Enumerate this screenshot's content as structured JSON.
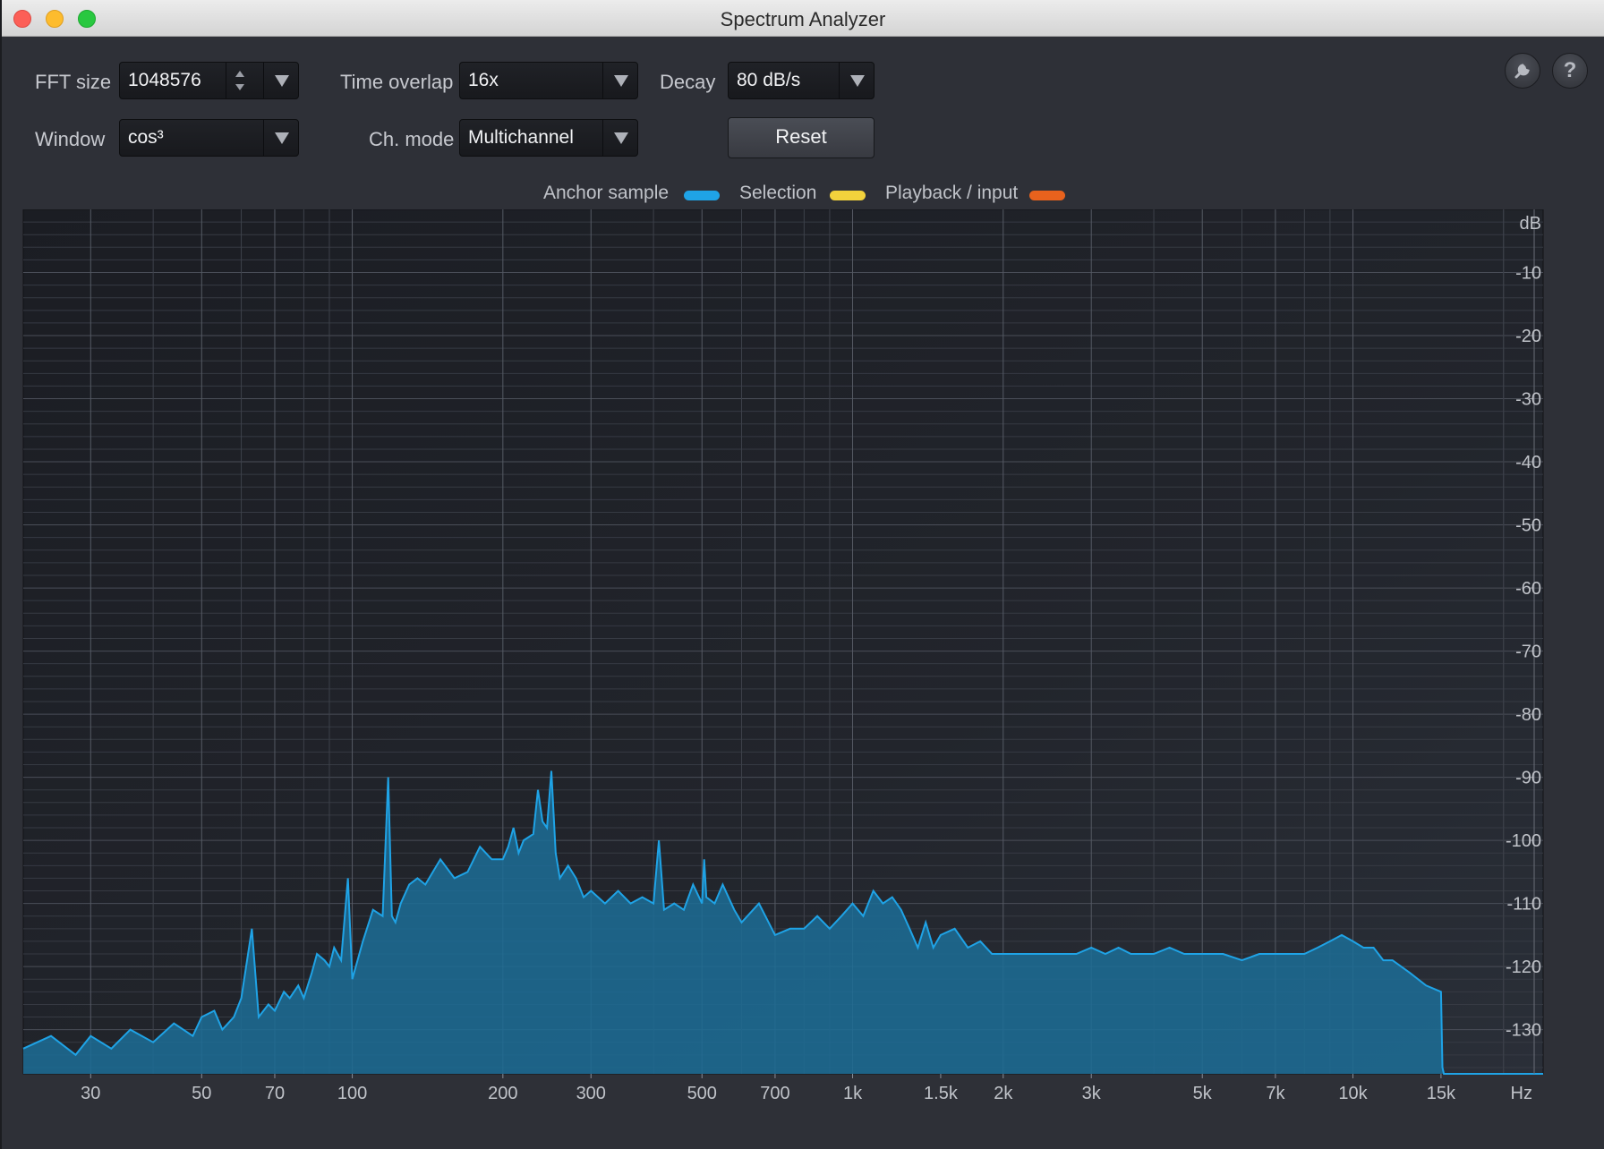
{
  "window": {
    "title": "Spectrum Analyzer"
  },
  "controls": {
    "fft_size": {
      "label": "FFT size",
      "value": "1048576"
    },
    "time_overlap": {
      "label": "Time overlap",
      "value": "16x"
    },
    "decay": {
      "label": "Decay",
      "value": "80 dB/s"
    },
    "window_fn": {
      "label": "Window",
      "value": "cos³"
    },
    "ch_mode": {
      "label": "Ch. mode",
      "value": "Multichannel"
    },
    "reset_label": "Reset",
    "settings_icon": "wrench-icon",
    "help_label": "?"
  },
  "legend": [
    {
      "name": "Anchor sample",
      "color": "#1fa3e6"
    },
    {
      "name": "Selection",
      "color": "#f2d23c"
    },
    {
      "name": "Playback / input",
      "color": "#e8621d"
    }
  ],
  "chart_data": {
    "type": "area",
    "x_scale": "log",
    "x_unit": "Hz",
    "y_unit": "dB",
    "xlim": [
      22,
      24000
    ],
    "ylim": [
      -137,
      0
    ],
    "x_ticks": [
      {
        "v": 30,
        "t": "30"
      },
      {
        "v": 50,
        "t": "50"
      },
      {
        "v": 70,
        "t": "70"
      },
      {
        "v": 100,
        "t": "100"
      },
      {
        "v": 200,
        "t": "200"
      },
      {
        "v": 300,
        "t": "300"
      },
      {
        "v": 500,
        "t": "500"
      },
      {
        "v": 700,
        "t": "700"
      },
      {
        "v": 1000,
        "t": "1k"
      },
      {
        "v": 1500,
        "t": "1.5k"
      },
      {
        "v": 2000,
        "t": "2k"
      },
      {
        "v": 3000,
        "t": "3k"
      },
      {
        "v": 5000,
        "t": "5k"
      },
      {
        "v": 7000,
        "t": "7k"
      },
      {
        "v": 10000,
        "t": "10k"
      },
      {
        "v": 15000,
        "t": "15k"
      }
    ],
    "y_ticks": [
      {
        "v": -10,
        "t": "-10"
      },
      {
        "v": -20,
        "t": "-20"
      },
      {
        "v": -30,
        "t": "-30"
      },
      {
        "v": -40,
        "t": "-40"
      },
      {
        "v": -50,
        "t": "-50"
      },
      {
        "v": -60,
        "t": "-60"
      },
      {
        "v": -70,
        "t": "-70"
      },
      {
        "v": -80,
        "t": "-80"
      },
      {
        "v": -90,
        "t": "-90"
      },
      {
        "v": -100,
        "t": "-100"
      },
      {
        "v": -110,
        "t": "-110"
      },
      {
        "v": -120,
        "t": "-120"
      },
      {
        "v": -130,
        "t": "-130"
      }
    ],
    "grid": true,
    "series": [
      {
        "color": "#1fa3e6",
        "fill": "#1c6d96",
        "x": [
          22,
          25,
          28,
          30,
          33,
          36,
          40,
          44,
          48,
          50,
          53,
          55,
          58,
          60,
          63,
          65,
          68,
          70,
          73,
          75,
          78,
          80,
          83,
          85,
          88,
          90,
          92,
          95,
          98,
          100,
          105,
          110,
          115,
          118,
          120,
          122,
          125,
          130,
          135,
          140,
          150,
          160,
          170,
          180,
          190,
          200,
          205,
          210,
          215,
          220,
          230,
          235,
          240,
          245,
          250,
          255,
          260,
          270,
          280,
          290,
          300,
          320,
          340,
          360,
          380,
          400,
          410,
          420,
          440,
          460,
          480,
          500,
          505,
          510,
          530,
          550,
          580,
          600,
          650,
          700,
          750,
          800,
          850,
          900,
          950,
          1000,
          1050,
          1100,
          1150,
          1200,
          1250,
          1300,
          1350,
          1400,
          1450,
          1500,
          1600,
          1700,
          1800,
          1900,
          2000,
          2200,
          2400,
          2600,
          2800,
          3000,
          3200,
          3400,
          3600,
          3800,
          4000,
          4300,
          4600,
          5000,
          5500,
          6000,
          6500,
          7000,
          7500,
          8000,
          8500,
          9000,
          9500,
          10000,
          10500,
          11000,
          11500,
          12000,
          13000,
          14000,
          15000,
          15100,
          15200,
          16000,
          20000,
          24000
        ],
        "y": [
          -133,
          -131,
          -134,
          -131,
          -133,
          -130,
          -132,
          -129,
          -131,
          -128,
          -127,
          -130,
          -128,
          -125,
          -114,
          -128,
          -126,
          -127,
          -124,
          -125,
          -123,
          -125,
          -121,
          -118,
          -119,
          -120,
          -117,
          -119,
          -106,
          -122,
          -116,
          -111,
          -112,
          -90,
          -112,
          -113,
          -110,
          -107,
          -106,
          -107,
          -103,
          -106,
          -105,
          -101,
          -103,
          -103,
          -101,
          -98,
          -102,
          -100,
          -99,
          -92,
          -97,
          -98,
          -89,
          -102,
          -106,
          -104,
          -106,
          -109,
          -108,
          -110,
          -108,
          -110,
          -109,
          -110,
          -100,
          -111,
          -110,
          -111,
          -107,
          -110,
          -103,
          -109,
          -110,
          -107,
          -111,
          -113,
          -110,
          -115,
          -114,
          -114,
          -112,
          -114,
          -112,
          -110,
          -112,
          -108,
          -110,
          -109,
          -111,
          -114,
          -117,
          -113,
          -117,
          -115,
          -114,
          -117,
          -116,
          -118,
          -118,
          -118,
          -118,
          -118,
          -118,
          -117,
          -118,
          -117,
          -118,
          -118,
          -118,
          -117,
          -118,
          -118,
          -118,
          -119,
          -118,
          -118,
          -118,
          -118,
          -117,
          -116,
          -115,
          -116,
          -117,
          -117,
          -119,
          -119,
          -121,
          -123,
          -124,
          -136,
          -137,
          -137,
          -137,
          -137
        ]
      }
    ]
  }
}
